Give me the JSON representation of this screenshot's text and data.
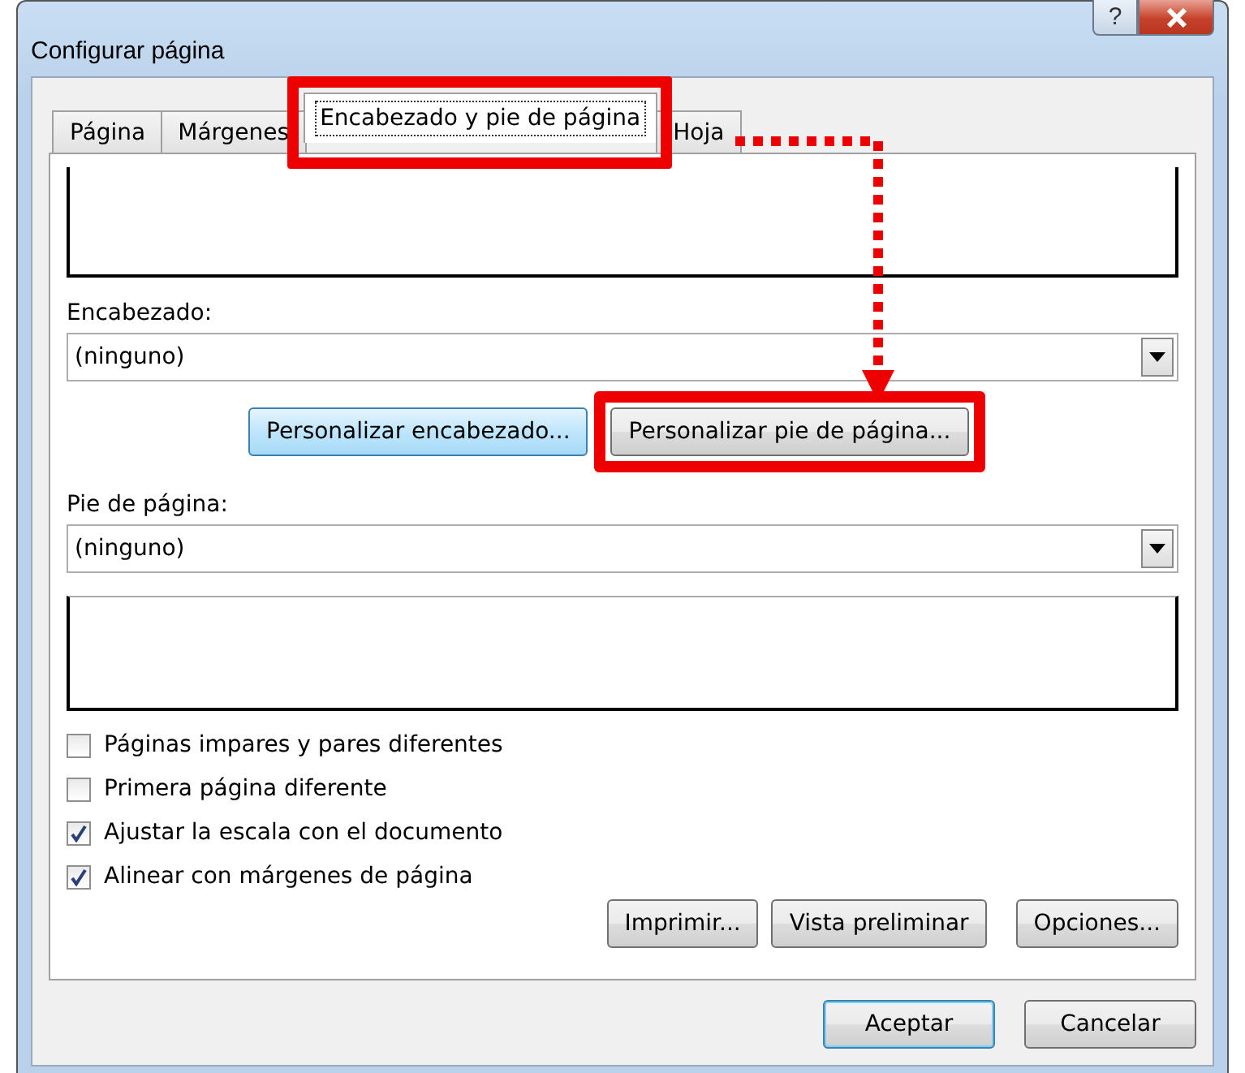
{
  "window": {
    "title": "Configurar página",
    "help": "?"
  },
  "tabs": [
    {
      "label": "Página",
      "selected": false,
      "highlighted": false
    },
    {
      "label": "Márgenes",
      "selected": false,
      "highlighted": false
    },
    {
      "label": "Encabezado y pie de página",
      "selected": true,
      "highlighted": true
    },
    {
      "label": "Hoja",
      "selected": false,
      "highlighted": false
    }
  ],
  "header": {
    "label": "Encabezado:",
    "value": "(ninguno)"
  },
  "custom_buttons": [
    {
      "label": "Personalizar encabezado...",
      "focused": true,
      "highlighted": false
    },
    {
      "label": "Personalizar pie de página...",
      "focused": false,
      "highlighted": true
    }
  ],
  "footer": {
    "label": "Pie de página:",
    "value": "(ninguno)"
  },
  "options": [
    {
      "label": "Páginas impares y pares diferentes",
      "checked": false
    },
    {
      "label": "Primera página diferente",
      "checked": false
    },
    {
      "label": "Ajustar la escala con el documento",
      "checked": true
    },
    {
      "label": "Alinear con márgenes de página",
      "checked": true
    }
  ],
  "page_buttons": [
    "Imprimir...",
    "Vista preliminar",
    "Opciones..."
  ],
  "dialog_buttons": [
    {
      "label": "Aceptar",
      "default": true
    },
    {
      "label": "Cancelar",
      "default": false
    }
  ]
}
